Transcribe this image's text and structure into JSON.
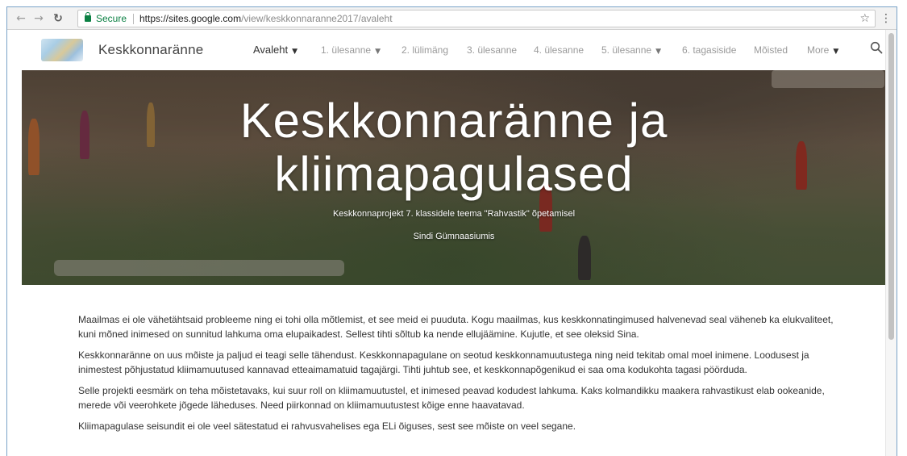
{
  "browser": {
    "secure_label": "Secure",
    "url_host": "https://sites.google.com",
    "url_path": "/view/keskkonnaranne2017/avaleht",
    "icons": {
      "back": "back-arrow-icon",
      "forward": "forward-arrow-icon",
      "reload": "reload-icon",
      "lock": "lock-icon",
      "bookmark": "star-icon",
      "menu": "more-vertical-icon"
    }
  },
  "site": {
    "title": "Keskkonnaränne",
    "nav": [
      {
        "label": "Avaleht",
        "dropdown": true,
        "current": true
      },
      {
        "label": "1. ülesanne",
        "dropdown": true
      },
      {
        "label": "2. lülimäng"
      },
      {
        "label": "3. ülesanne"
      },
      {
        "label": "4. ülesanne"
      },
      {
        "label": "5. ülesanne",
        "dropdown": true
      },
      {
        "label": "6. tagasiside"
      },
      {
        "label": "Mõisted"
      },
      {
        "label": "More",
        "dropdown": true
      }
    ],
    "search_icon": "search-icon"
  },
  "hero": {
    "title_line1": "Keskkonnaränne ja",
    "title_line2": "kliimapagulased",
    "subtitle": "Keskkonnaprojekt 7. klassidele teema \"Rahvastik\" õpetamisel",
    "school": "Sindi Gümnaasiumis"
  },
  "content": {
    "paragraphs": [
      "Maailmas ei ole vähetähtsaid probleeme ning ei tohi olla mõtlemist, et see meid ei puuduta. Kogu maailmas, kus keskkonnatingimused halvenevad seal väheneb ka elukvaliteet, kuni mõned inimesed on sunnitud lahkuma oma elupaikadest. Sellest tihti sõltub ka nende ellujäämine. Kujutle, et see oleksid Sina.",
      "Keskkonnaränne on uus mõiste ja paljud ei teagi selle tähendust. Keskkonnapagulane on seotud keskkonnamuutustega ning neid tekitab omal moel inimene.  Loodusest ja inimestest põhjustatud kliimamuutused kannavad etteaimamatuid tagajärgi. Tihti juhtub see, et keskkonnapõgenikud ei saa oma kodukohta tagasi pöörduda.",
      "Selle projekti eesmärk on teha mõistetavaks, kui suur roll on kliimamuutustel, et inimesed peavad kodudest lahkuma. Kaks kolmandikku maakera rahvastikust elab ookeanide, merede või veerohkete jõgede läheduses. Need piirkonnad on kliimamuutustest kõige enne haavatavad.",
      "Kliimapagulase seisundit ei ole veel sätestatud ei rahvusvahelises ega ELi õiguses, sest see mõiste on veel segane."
    ]
  }
}
